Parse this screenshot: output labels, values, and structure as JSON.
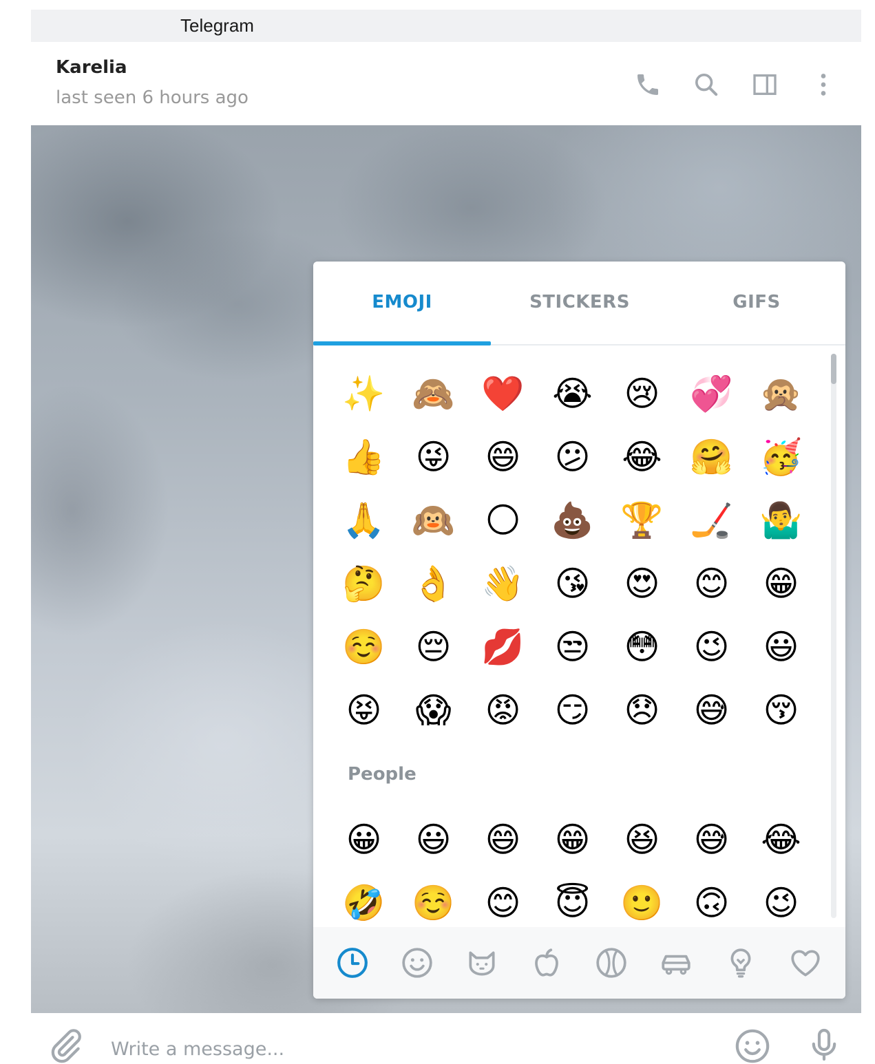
{
  "window": {
    "title": "Telegram"
  },
  "chat": {
    "name": "Karelia",
    "status": "last seen 6 hours ago"
  },
  "header_icons": [
    "phone-icon",
    "search-icon",
    "sidebar-toggle-icon",
    "more-vertical-icon"
  ],
  "panel": {
    "tabs": [
      {
        "label": "EMOJI",
        "active": true
      },
      {
        "label": "STICKERS",
        "active": false
      },
      {
        "label": "GIFS",
        "active": false
      }
    ],
    "recent": [
      "✨",
      "🙈",
      "❤️",
      "😭",
      "😢",
      "💞",
      "🙊",
      "👍",
      "😜",
      "😄",
      "😕",
      "😂",
      "🤗",
      "🥳",
      "🙏",
      "🙉",
      "🌕",
      "💩",
      "🏆",
      "🏒",
      "🤷‍♂️",
      "🤔",
      "👌",
      "👋",
      "😘",
      "😍",
      "😊",
      "😁",
      "☺️",
      "😔",
      "💋",
      "😒",
      "😳",
      "😉",
      "😃",
      "😝",
      "😱",
      "😡",
      "😏",
      "😞",
      "😅",
      "😚"
    ],
    "people_label": "People",
    "people": [
      "😀",
      "😃",
      "😄",
      "😁",
      "😆",
      "😅",
      "😂",
      "🤣",
      "☺️",
      "😊",
      "😇",
      "🙂",
      "🙃",
      "😉"
    ],
    "categories": [
      {
        "icon": "clock-icon",
        "active": true
      },
      {
        "icon": "smiley-icon",
        "active": false
      },
      {
        "icon": "cat-icon",
        "active": false
      },
      {
        "icon": "apple-icon",
        "active": false
      },
      {
        "icon": "ball-icon",
        "active": false
      },
      {
        "icon": "car-icon",
        "active": false
      },
      {
        "icon": "lightbulb-icon",
        "active": false
      },
      {
        "icon": "heart-icon",
        "active": false
      }
    ],
    "accent_color": "#168acd"
  },
  "composer": {
    "placeholder": "Write a message..."
  }
}
